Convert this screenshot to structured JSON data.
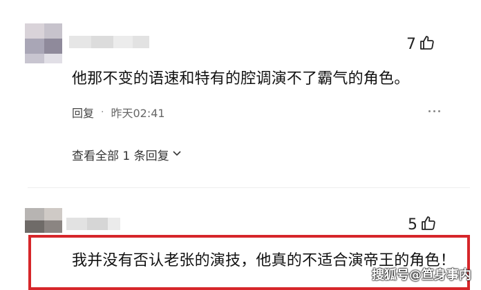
{
  "comments": [
    {
      "likes": "7",
      "text": "他那不变的语速和特有的腔调演不了霸气的角色。",
      "reply_label": "回复",
      "time": "昨天02:41",
      "view_replies": "查看全部 1 条回复"
    },
    {
      "likes": "5",
      "text": "我并没有否认老张的演技，他真的不适合演帝王的角色！"
    }
  ],
  "watermark": "搜狐号@笪身事内",
  "colors": {
    "highlight_border": "#d6262a"
  }
}
